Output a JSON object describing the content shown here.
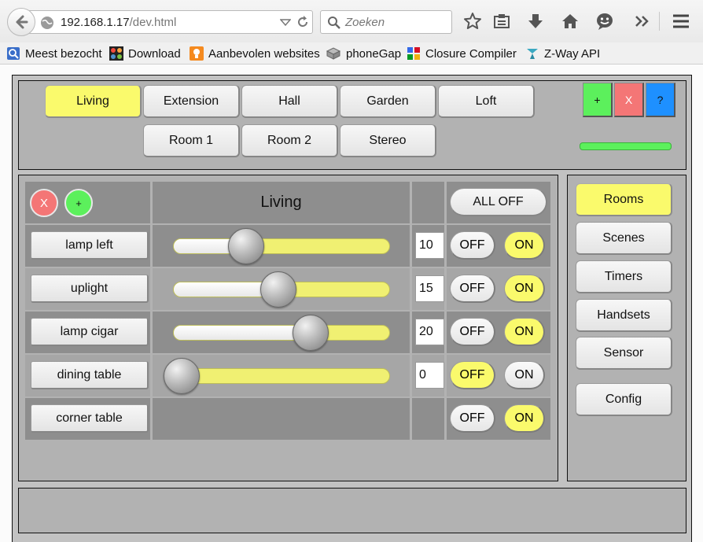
{
  "browser": {
    "url_host": "192.168.1.17",
    "url_path": "/dev.html",
    "search_placeholder": "Zoeken",
    "bookmarks": [
      "Meest bezocht",
      "Download",
      "Aanbevolen websites",
      "phoneGap",
      "Closure Compiler",
      "Z-Way API"
    ]
  },
  "rooms": {
    "tabs": [
      "Living",
      "Extension",
      "Hall",
      "Garden",
      "Loft",
      "Room 1",
      "Room 2",
      "Stereo"
    ],
    "active": "Living"
  },
  "actions": {
    "add": "+",
    "remove": "X",
    "help": "?"
  },
  "colors": {
    "accent_yellow": "#fafa6c",
    "add_green": "#5cf05c",
    "remove_red": "#f47676",
    "help_blue": "#1e90ff"
  },
  "room": {
    "title": "Living",
    "remove_label": "X",
    "add_label": "+",
    "all_off_label": "ALL OFF",
    "devices": [
      {
        "name": "lamp left",
        "dimmer": true,
        "level": 10,
        "state": "ON"
      },
      {
        "name": "uplight",
        "dimmer": true,
        "level": 15,
        "state": "ON"
      },
      {
        "name": "lamp cigar",
        "dimmer": true,
        "level": 20,
        "state": "ON"
      },
      {
        "name": "dining table",
        "dimmer": true,
        "level": 0,
        "state": "OFF"
      },
      {
        "name": "corner table",
        "dimmer": false,
        "state": "ON"
      }
    ],
    "off_label": "OFF",
    "on_label": "ON"
  },
  "menu": [
    "Rooms",
    "Scenes",
    "Timers",
    "Handsets",
    "Sensor",
    "Config"
  ],
  "menu_active": "Rooms"
}
